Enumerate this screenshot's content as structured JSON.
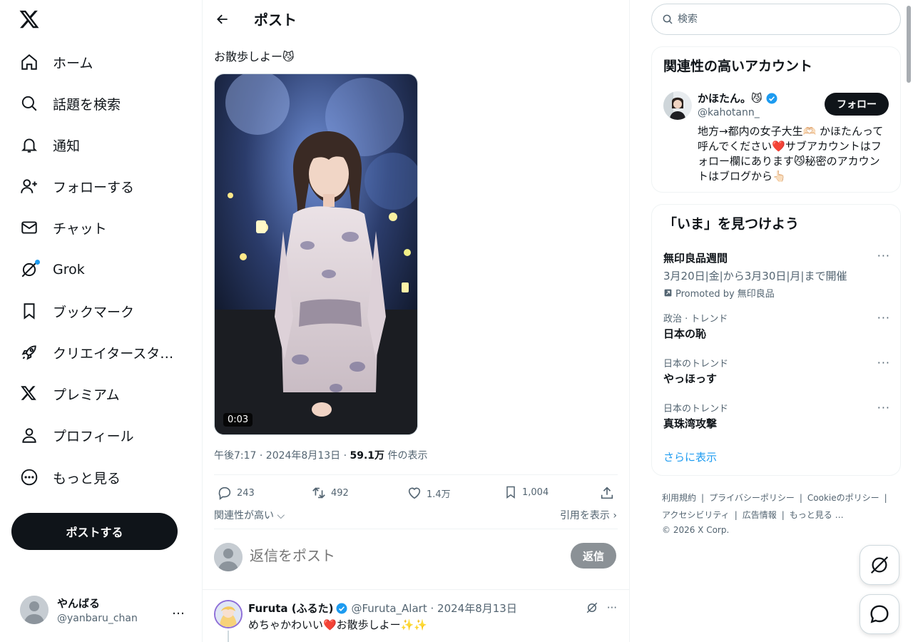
{
  "nav": {
    "items": [
      {
        "label": "ホーム",
        "icon": "home-icon"
      },
      {
        "label": "話題を検索",
        "icon": "search-icon"
      },
      {
        "label": "通知",
        "icon": "bell-icon"
      },
      {
        "label": "フォローする",
        "icon": "person-add-icon"
      },
      {
        "label": "チャット",
        "icon": "mail-icon"
      },
      {
        "label": "Grok",
        "icon": "grok-icon"
      },
      {
        "label": "ブックマーク",
        "icon": "bookmark-icon"
      },
      {
        "label": "クリエイタースタ…",
        "icon": "rocket-icon"
      },
      {
        "label": "プレミアム",
        "icon": "x-icon"
      },
      {
        "label": "プロフィール",
        "icon": "person-icon"
      },
      {
        "label": "もっと見る",
        "icon": "more-circle-icon"
      }
    ],
    "post_button": "ポストする"
  },
  "account": {
    "name": "やんばる",
    "handle": "@yanbaru_chan",
    "more": "…"
  },
  "header": {
    "title": "ポスト"
  },
  "post": {
    "text": "お散歩しよー😼",
    "video_duration": "0:03",
    "meta_prefix": "午後7:17 · 2024年8月13日 · ",
    "views": "59.1万",
    "views_suffix": " 件の表示",
    "replies": "243",
    "reposts": "492",
    "likes": "1.4万",
    "bookmarks": "1,004"
  },
  "sort": {
    "label": "関連性が高い",
    "quotes": "引用を表示"
  },
  "reply_box": {
    "placeholder": "返信をポスト",
    "button": "返信"
  },
  "reply": {
    "name": "Furuta (ふるた)",
    "handle_date": "@Furuta_Alart · 2024年8月13日",
    "text": "めちゃかわいい❤️お散歩しよー✨✨"
  },
  "search": {
    "placeholder": "検索"
  },
  "related": {
    "title": "関連性の高いアカウント",
    "name": "かほたん。😼",
    "handle": "@kahotann_",
    "follow": "フォロー",
    "bio": "地方→都内の女子大生🫶🏻 かほたんって呼んでください❤️サブアカウントはフォロー欄にあります😼秘密のアカウントはブログから👆🏻"
  },
  "trends": {
    "title": "「いま」を見つけよう",
    "promoted": {
      "title": "無印良品週間",
      "subtitle": "3月20日|金|から3月30日|月|まで開催",
      "promo": "Promoted by 無印良品"
    },
    "items": [
      {
        "context": "政治 · トレンド",
        "title": "日本の恥"
      },
      {
        "context": "日本のトレンド",
        "title": "やっほっす"
      },
      {
        "context": "日本のトレンド",
        "title": "真珠湾攻撃"
      }
    ],
    "show_more": "さらに表示",
    "more": "···"
  },
  "footer": {
    "links": [
      "利用規約",
      "|",
      "プライバシーポリシー",
      "|",
      "Cookieのポリシー",
      "|",
      "アクセシビリティ",
      "|",
      "広告情報",
      "|",
      "もっと見る …"
    ],
    "copyright": "© 2026 X Corp."
  },
  "colors": {
    "accent": "#1d9bf0",
    "text": "#0f1419",
    "muted": "#536471",
    "border": "#eff3f4",
    "heart": "#f91880"
  }
}
